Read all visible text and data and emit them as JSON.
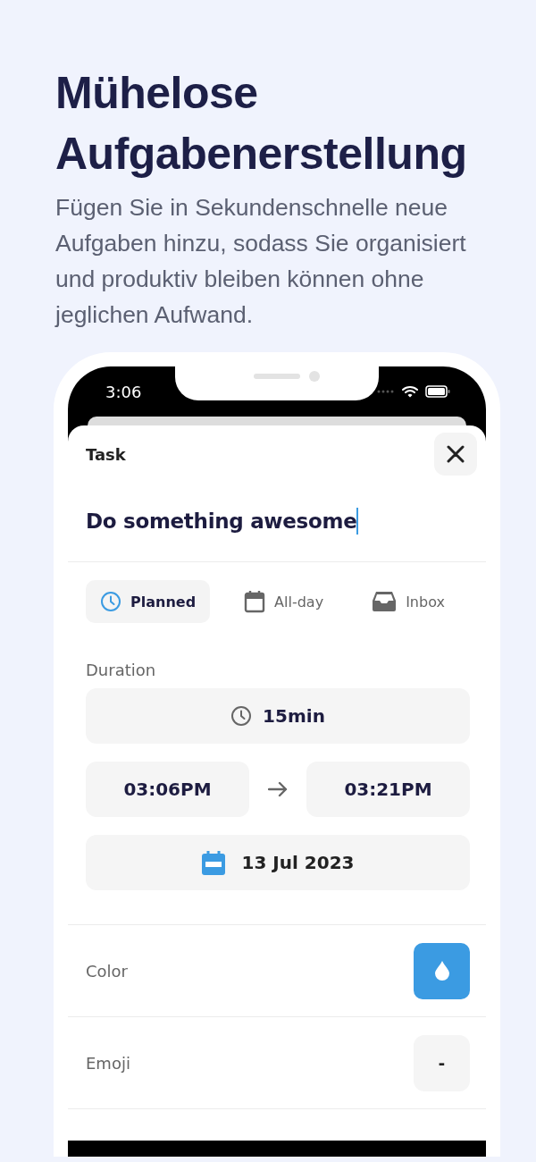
{
  "headline": "Mühelose Aufgabenerstellung",
  "subtitle": "Fügen Sie in Sekundenschnelle neue Aufgaben hinzu, sodass Sie organisiert und produktiv bleiben können ohne jeglichen Aufwand.",
  "status_bar": {
    "time": "3:06"
  },
  "sheet": {
    "title": "Task",
    "task_name": "Do something awesome",
    "modes": [
      {
        "kind": "clock",
        "label": "Planned",
        "selected": true
      },
      {
        "kind": "calendar",
        "label": "All-day",
        "selected": false
      },
      {
        "kind": "inbox",
        "label": "Inbox",
        "selected": false
      }
    ],
    "duration_label": "Duration",
    "duration": "15min",
    "start_time": "03:06PM",
    "end_time": "03:21PM",
    "date": "13 Jul 2023",
    "color_label": "Color",
    "color": "#3b9be2",
    "emoji_label": "Emoji",
    "emoji": "-"
  }
}
